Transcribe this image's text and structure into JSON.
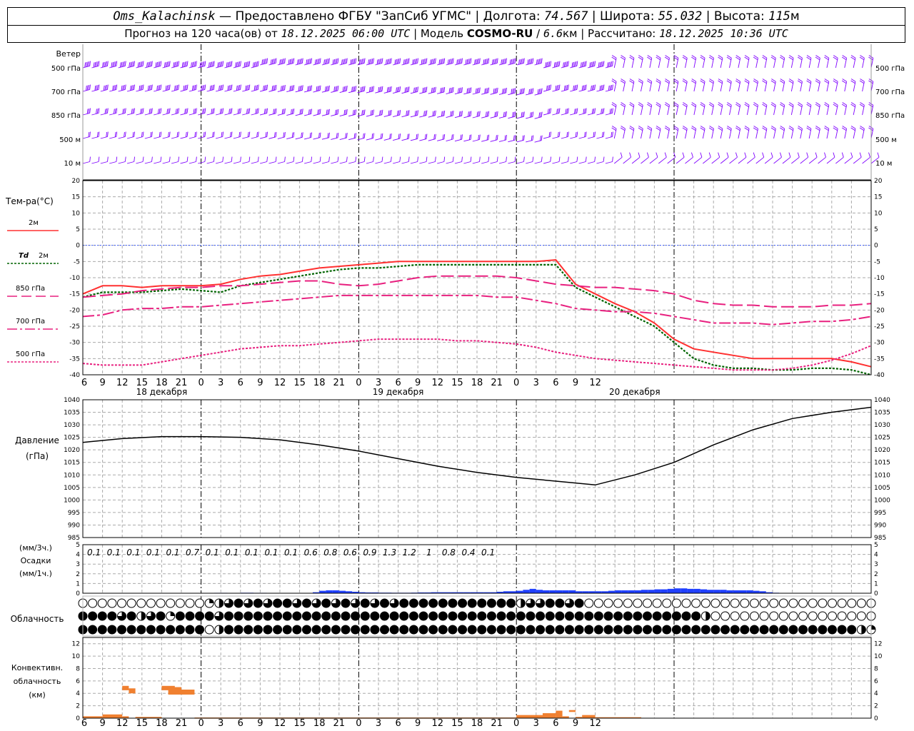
{
  "header": {
    "station": "Oms_Kalachinsk",
    "dash": "—",
    "provided_by": "Предоставлено ФГБУ \"ЗапСиб УГМС\"",
    "lon_label": "Долгота:",
    "lon_value": "74.567",
    "lat_label": "Широта:",
    "lat_value": "55.032",
    "alt_label": "Высота:",
    "alt_value": "115",
    "alt_unit": "м",
    "forecast_label": "Прогноз на 120 часа(ов) от",
    "forecast_start": "18.12.2025 06:00 UTC",
    "model_label": "Модель",
    "model_name": "COSMO-RU",
    "model_res": "6.6",
    "model_res_unit": "км",
    "calc_label": "Рассчитано:",
    "calc_time": "18.12.2025 10:36 UTC",
    "sep": "|"
  },
  "labels": {
    "wind": "Ветер",
    "wind_levels": [
      "500 гПа",
      "700 гПа",
      "850 гПа",
      "500 м",
      "10  м"
    ],
    "temp": "Тем-ра(°C)",
    "t2m": "2м",
    "td": "Td",
    "td_level": "2м",
    "t850": "850 гПа",
    "t700": "700 гПа",
    "t500": "500 гПа",
    "pressure": "Давление",
    "pressure_unit": "(гПа)",
    "precip_3h": "(мм/3ч.)",
    "precip": "Осадки",
    "precip_1h": "(мм/1ч.)",
    "cloud": "Облачность",
    "conv1": "Конвективн.",
    "conv2": "облачность",
    "conv3": "(км)"
  },
  "colors": {
    "t2m": "#ff3030",
    "td": "#006400",
    "t850": "#e8207f",
    "t700": "#e8207f",
    "t500": "#e8207f",
    "wind": "#7f00ff",
    "precip": "#1f3fff",
    "conv": "#f08030",
    "zero_line": "#4060ff"
  },
  "chart_data": [
    {
      "type": "line",
      "title": "Тем-ра(°C)",
      "x_unit": "hours since 18.12.2025 06:00 UTC",
      "x_ticks": [
        "6",
        "9",
        "12",
        "15",
        "18",
        "21",
        "0",
        "3",
        "6",
        "9",
        "12",
        "15",
        "18",
        "21",
        "0",
        "3",
        "6",
        "9",
        "12",
        "15",
        "18",
        "21",
        "0",
        "3",
        "6",
        "9",
        "12"
      ],
      "day_labels": [
        "18 декабря",
        "19 декабря",
        "20 декабря"
      ],
      "ylim": [
        -40,
        20
      ],
      "y_ticks": [
        20,
        15,
        10,
        5,
        0,
        -5,
        -10,
        -15,
        -20,
        -25,
        -30,
        -35,
        -40
      ],
      "series": [
        {
          "name": "2м",
          "x": [
            0,
            3,
            6,
            9,
            12,
            15,
            18,
            21,
            24,
            27,
            30,
            33,
            36,
            39,
            42,
            45,
            48,
            51,
            54,
            57,
            60,
            63,
            66,
            69,
            72,
            75,
            78,
            81,
            84,
            87,
            90,
            93,
            96,
            99,
            102,
            105,
            108,
            111,
            114,
            117,
            120
          ],
          "values": [
            -15,
            -12.5,
            -12.5,
            -13,
            -12.5,
            -12.5,
            -12.5,
            -12,
            -10.5,
            -9.5,
            -9,
            -8,
            -7,
            -6.5,
            -6,
            -5.5,
            -5,
            -5,
            -5,
            -5,
            -5,
            -5,
            -5,
            -5,
            -4.5,
            -12,
            -15,
            -18,
            -20.5,
            -24,
            -29,
            -32,
            -33,
            -34,
            -35,
            -35,
            -35,
            -35,
            -35,
            -36,
            -37.5
          ]
        },
        {
          "name": "Td 2м",
          "x": [
            0,
            3,
            6,
            9,
            12,
            15,
            18,
            21,
            24,
            27,
            30,
            33,
            36,
            39,
            42,
            45,
            48,
            51,
            54,
            57,
            60,
            63,
            66,
            69,
            72,
            75,
            78,
            81,
            84,
            87,
            90,
            93,
            96,
            99,
            102,
            105,
            108,
            111,
            114,
            117,
            120
          ],
          "values": [
            -16,
            -14.5,
            -14.5,
            -14.5,
            -14,
            -13.5,
            -14,
            -14.5,
            -12.5,
            -11.5,
            -10.5,
            -9.5,
            -8.5,
            -7.5,
            -7,
            -7,
            -6.5,
            -6,
            -6,
            -6,
            -6,
            -6,
            -6,
            -6,
            -6,
            -13,
            -16,
            -19,
            -22,
            -25,
            -30,
            -35,
            -37,
            -38,
            -38,
            -38.5,
            -38.5,
            -38,
            -38,
            -38.5,
            -40
          ]
        },
        {
          "name": "850 гПа",
          "x": [
            0,
            3,
            6,
            9,
            12,
            15,
            18,
            21,
            24,
            27,
            30,
            33,
            36,
            39,
            42,
            45,
            48,
            51,
            54,
            57,
            60,
            63,
            66,
            69,
            72,
            75,
            78,
            81,
            84,
            87,
            90,
            93,
            96,
            99,
            102,
            105,
            108,
            111,
            114,
            117,
            120
          ],
          "values": [
            -16,
            -15.5,
            -15,
            -14,
            -13.5,
            -13,
            -13,
            -12.5,
            -12.5,
            -12,
            -11.5,
            -11,
            -11,
            -12,
            -12.5,
            -12,
            -11,
            -10,
            -9.5,
            -9.5,
            -9.5,
            -9.5,
            -10,
            -11,
            -12,
            -12.5,
            -13,
            -13,
            -13.5,
            -14,
            -15,
            -17,
            -18,
            -18.5,
            -18.5,
            -19,
            -19,
            -19,
            -18.5,
            -18.5,
            -18
          ]
        },
        {
          "name": "700 гПа",
          "x": [
            0,
            3,
            6,
            9,
            12,
            15,
            18,
            21,
            24,
            27,
            30,
            33,
            36,
            39,
            42,
            45,
            48,
            51,
            54,
            57,
            60,
            63,
            66,
            69,
            72,
            75,
            78,
            81,
            84,
            87,
            90,
            93,
            96,
            99,
            102,
            105,
            108,
            111,
            114,
            117,
            120
          ],
          "values": [
            -22,
            -21.5,
            -20,
            -19.5,
            -19.5,
            -19,
            -19,
            -18.5,
            -18,
            -17.5,
            -17,
            -16.5,
            -16,
            -15.5,
            -15.5,
            -15.5,
            -15.5,
            -15.5,
            -15.5,
            -15.5,
            -15.5,
            -16,
            -16,
            -17,
            -18,
            -19.5,
            -20,
            -20.5,
            -20.5,
            -21,
            -22,
            -23,
            -24,
            -24,
            -24,
            -24.5,
            -24,
            -23.5,
            -23.5,
            -23,
            -22
          ]
        },
        {
          "name": "500 гПа",
          "x": [
            0,
            3,
            6,
            9,
            12,
            15,
            18,
            21,
            24,
            27,
            30,
            33,
            36,
            39,
            42,
            45,
            48,
            51,
            54,
            57,
            60,
            63,
            66,
            69,
            72,
            75,
            78,
            81,
            84,
            87,
            90,
            93,
            96,
            99,
            102,
            105,
            108,
            111,
            114,
            117,
            120
          ],
          "values": [
            -36.5,
            -37,
            -37,
            -37,
            -36,
            -35,
            -34,
            -33,
            -32,
            -31.5,
            -31,
            -31,
            -30.5,
            -30,
            -29.5,
            -29,
            -29,
            -29,
            -29,
            -29.5,
            -29.5,
            -30,
            -30.5,
            -31.5,
            -33,
            -34,
            -35,
            -35.5,
            -36,
            -36.5,
            -37,
            -37.5,
            -38,
            -38.5,
            -38.5,
            -38.5,
            -38,
            -37,
            -35.5,
            -33.5,
            -31
          ]
        }
      ]
    },
    {
      "type": "line",
      "title": "Давление",
      "ylabel": "(гПа)",
      "ylim": [
        985,
        1040
      ],
      "y_ticks": [
        1040,
        1035,
        1030,
        1025,
        1020,
        1015,
        1010,
        1005,
        1000,
        995,
        990,
        985
      ],
      "series": [
        {
          "name": "Давление",
          "x": [
            0,
            6,
            12,
            18,
            24,
            30,
            36,
            42,
            48,
            54,
            60,
            66,
            72,
            78,
            84,
            90,
            96,
            102,
            108,
            114,
            120
          ],
          "values": [
            1023,
            1024.5,
            1025.3,
            1025.3,
            1025,
            1024,
            1022,
            1019.5,
            1016.5,
            1013.5,
            1011,
            1009,
            1007.5,
            1006,
            1010,
            1015,
            1022,
            1028,
            1032.5,
            1035,
            1037
          ]
        }
      ]
    },
    {
      "type": "bar",
      "title": "Осадки",
      "ylim": [
        0,
        5
      ],
      "y_ticks": [
        5,
        4,
        3,
        2,
        1,
        0
      ],
      "sums_3h": [
        "0.1",
        "0.1",
        "0.1",
        "0.1",
        "0.1",
        "0.7",
        "0.1",
        "0.1",
        "0.1",
        "0.1",
        "0.1",
        "0.6",
        "0.8",
        "0.6",
        "0.9",
        "1.3",
        "1.2",
        "1",
        "0.8",
        "0.4",
        "0.1"
      ],
      "sums_3h_x": [
        3,
        6,
        9,
        12,
        15,
        18,
        21,
        24,
        27,
        30,
        33,
        36,
        39,
        42,
        45,
        48,
        51,
        54,
        57,
        60,
        63
      ],
      "hourly_x": [
        0,
        1,
        2,
        3,
        4,
        5,
        6,
        7,
        8,
        9,
        10,
        11,
        12,
        13,
        14,
        15,
        16,
        17,
        18,
        19,
        20,
        21,
        22,
        23,
        24,
        25,
        26,
        27,
        28,
        29,
        30,
        31,
        32,
        33,
        34,
        35,
        36,
        37,
        38,
        39,
        40,
        41,
        42,
        43,
        44,
        45,
        46,
        47,
        48,
        49,
        50,
        51,
        52,
        53,
        54,
        55,
        56,
        57,
        58,
        59,
        60,
        61,
        62,
        63,
        64,
        65,
        66,
        67,
        68,
        69,
        70,
        71,
        72,
        73,
        74,
        75,
        76,
        77,
        78,
        79,
        80,
        81,
        82,
        83,
        84,
        85,
        86,
        87,
        88,
        89,
        90
      ],
      "hourly_values": [
        0.02,
        0.02,
        0.03,
        0.03,
        0.03,
        0.04,
        0.04,
        0.03,
        0.03,
        0.05,
        0.05,
        0.04,
        0.04,
        0.03,
        0.03,
        0.03,
        0.03,
        0.03,
        0.03,
        0.03,
        0.1,
        0.25,
        0.3,
        0.3,
        0.25,
        0.2,
        0.15,
        0.1,
        0.08,
        0.08,
        0.06,
        0.06,
        0.05,
        0.05,
        0.05,
        0.06,
        0.08,
        0.08,
        0.1,
        0.1,
        0.1,
        0.1,
        0.1,
        0.1,
        0.1,
        0.1,
        0.1,
        0.1,
        0.15,
        0.2,
        0.2,
        0.25,
        0.35,
        0.45,
        0.35,
        0.3,
        0.3,
        0.3,
        0.3,
        0.3,
        0.2,
        0.2,
        0.2,
        0.2,
        0.2,
        0.25,
        0.3,
        0.3,
        0.3,
        0.3,
        0.35,
        0.35,
        0.4,
        0.4,
        0.45,
        0.5,
        0.5,
        0.45,
        0.45,
        0.4,
        0.35,
        0.35,
        0.35,
        0.3,
        0.3,
        0.3,
        0.3,
        0.25,
        0.2,
        0.1,
        0.05
      ]
    },
    {
      "type": "bar",
      "title": "Конвективн. облачность (км)",
      "ylim": [
        0,
        13
      ],
      "y_ticks": [
        12,
        10,
        8,
        6,
        4,
        2,
        0
      ],
      "bars": [
        {
          "x0": 0,
          "x1": 3,
          "bottom": 0,
          "top": 0.3
        },
        {
          "x0": 3,
          "x1": 6,
          "bottom": 0,
          "top": 0.6
        },
        {
          "x0": 6,
          "x1": 7,
          "bottom": 0,
          "top": 0.3
        },
        {
          "x0": 6,
          "x1": 7,
          "bottom": 4.5,
          "top": 5.2
        },
        {
          "x0": 7,
          "x1": 8,
          "bottom": 4,
          "top": 4.8
        },
        {
          "x0": 8,
          "x1": 12,
          "bottom": 0,
          "top": 0.2
        },
        {
          "x0": 12,
          "x1": 14,
          "bottom": 4.5,
          "top": 5.2
        },
        {
          "x0": 13,
          "x1": 15,
          "bottom": 3.8,
          "top": 5
        },
        {
          "x0": 15,
          "x1": 17,
          "bottom": 3.8,
          "top": 4.6
        },
        {
          "x0": 17,
          "x1": 66,
          "bottom": 0,
          "top": 0.1
        },
        {
          "x0": 66,
          "x1": 70,
          "bottom": 0,
          "top": 0.5
        },
        {
          "x0": 70,
          "x1": 72,
          "bottom": 0,
          "top": 0.8
        },
        {
          "x0": 72,
          "x1": 73,
          "bottom": 0,
          "top": 1.2
        },
        {
          "x0": 73,
          "x1": 74,
          "bottom": 0,
          "top": 0.3
        },
        {
          "x0": 74,
          "x1": 75,
          "bottom": 1,
          "top": 1.3
        },
        {
          "x0": 75,
          "x1": 76,
          "bottom": 0,
          "top": 0.2
        },
        {
          "x0": 76,
          "x1": 78,
          "bottom": 0,
          "top": 0.5
        },
        {
          "x0": 78,
          "x1": 85,
          "bottom": 0,
          "top": 0.15
        }
      ]
    },
    {
      "type": "table",
      "title": "Облачность",
      "rows": [
        "0000000000000123434344343434343434444444444442334434000000000000000000000000000000",
        "4444342341444434444444444444444444444444444444444444444444444444200000000000000000",
        "4444444444444024444444444444444444444444444444444444444444444444444444444444444421"
      ]
    }
  ]
}
